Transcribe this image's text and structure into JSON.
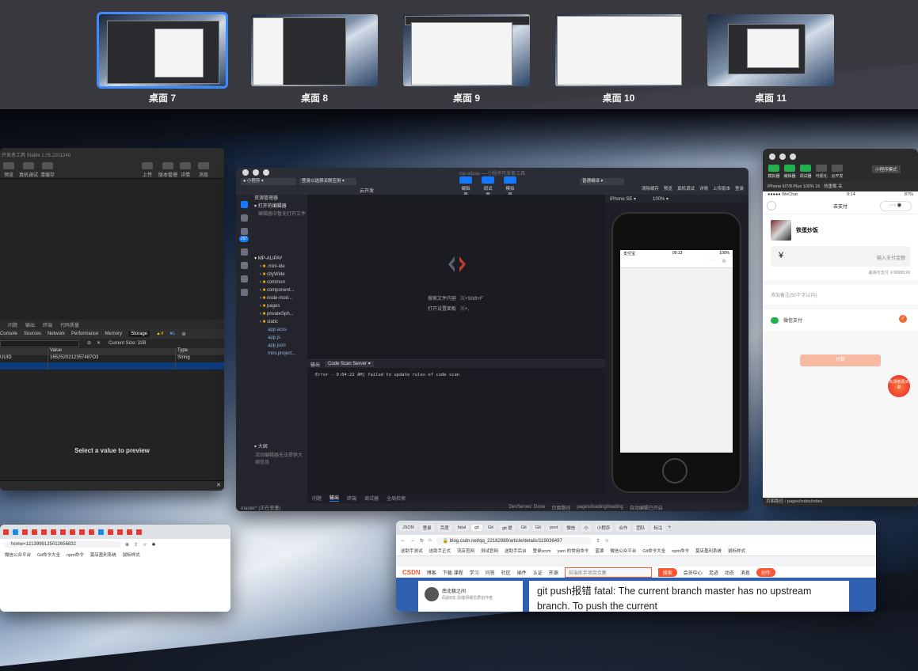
{
  "spaces": [
    {
      "label": "桌面 7",
      "selected": true
    },
    {
      "label": "桌面 8",
      "selected": false
    },
    {
      "label": "桌面 9",
      "selected": false
    },
    {
      "label": "桌面 10",
      "selected": false
    },
    {
      "label": "桌面 11",
      "selected": false
    }
  ],
  "left_window": {
    "title": "开发者工具 Stable 1.05.2201240",
    "toolbar": [
      "预览",
      "真机调试",
      "清缓存",
      "上传",
      "版本管理",
      "详情",
      "消息"
    ],
    "panel_tabs": [
      "问题",
      "输出",
      "终端",
      "代码质量"
    ],
    "devtools_tabs": [
      "Console",
      "Sources",
      "Network",
      "Performance",
      "Memory",
      "Storage"
    ],
    "active_tab": "Storage",
    "warnings": "4",
    "errors": "1",
    "current_size": "Current Size: 32B",
    "columns": [
      "Value",
      "Type"
    ],
    "rows": [
      {
        "key": "UUID",
        "value": "1652520212357487O3",
        "type": "String"
      }
    ],
    "preview_text": "Select a value to preview"
  },
  "ide": {
    "title": "mp-alipay — 小程序开发者工具",
    "project_select": "小程序",
    "login_select": "登录以选择关联应用",
    "cloud_label": "云开发",
    "center_buttons": [
      {
        "label": "编辑器",
        "on": true
      },
      {
        "label": "调试器",
        "on": true
      },
      {
        "label": "模拟器",
        "on": true
      }
    ],
    "compile_select": "普通编译",
    "right_buttons": [
      "清除缓存",
      "预览",
      "真机调试",
      "详情",
      "上传版本",
      "登录"
    ],
    "badge": "297",
    "explorer_title": "资源管理器",
    "open_editors": "打开的编辑器",
    "no_open": "编辑器中暂无打开文件",
    "project_root": "MP-ALIPAY",
    "folders": [
      ".mini-ide",
      "cityWide",
      "common",
      "component...",
      "node-mod...",
      "pages",
      "privateSph...",
      "static"
    ],
    "files": [
      "app.acss",
      "app.js",
      "app.json",
      "mini.project..."
    ],
    "hint_search": "搜索文件内容",
    "hint_search_key": "⌘+Shift+F",
    "hint_settings": "打开设置面板",
    "hint_settings_key": "⌘+,",
    "panel_title": "输出",
    "panel_select": "Code Scan Server",
    "log_line": "Error - 9:04:22 AM] failed to update rules of code scan",
    "outline_title": "大纲",
    "outline_text": "活动编辑器无法提供大纲信息",
    "bottom_tabs": [
      "问题",
      "输出",
      "终端",
      "调试器",
      "全局检索"
    ],
    "active_bottom_tab": "输出",
    "device": "iPhone SE",
    "zoom": "100%",
    "phone_carrier": "支付宝",
    "phone_time": "09:13",
    "phone_battery": "100%",
    "status_branch": "master* (正在变基)",
    "status_devserver": "DevServer: Done",
    "status_page_label": "页面路径",
    "status_page": "pages/loading/loading",
    "status_auto": "自动编辑已开启"
  },
  "mp_window": {
    "toolbar": [
      {
        "label": "模拟器",
        "green": true
      },
      {
        "label": "编辑器",
        "green": true
      },
      {
        "label": "调试器",
        "green": true
      },
      {
        "label": "可视化",
        "green": false
      },
      {
        "label": "云开发",
        "green": false
      }
    ],
    "mode": "小程序模式",
    "device": "iPhone 6/7/8 Plus 100% 16",
    "hot_reload": "热重载 关",
    "carrier": "●●●●● WeChat",
    "time": "9:14",
    "battery": "87%",
    "page_title": "去支付",
    "merchant": "铁蛋炒饭",
    "currency": "¥",
    "amount_placeholder": "输入支付金额",
    "max_pay": "最高可支付 ￥99999.99",
    "remark": "添加备注(50个字以内)",
    "pay_method": "微信支付",
    "pay_button": "付款",
    "promo": "先领券再买单",
    "footer_label": "页面路径",
    "footer_path": "pages/index/index"
  },
  "browser_left": {
    "url_tail": "home=1213999125012656832",
    "bookmarks": [
      "微信公众平台",
      "Git命令大全",
      "npm命令",
      "莫店盈利系统",
      "鼠标样式"
    ]
  },
  "browser_right": {
    "tabs": [
      "JSON",
      "登录",
      "百度",
      "fatal",
      "git",
      "Git",
      "git 提",
      "Git",
      "Git",
      "post",
      "微信",
      "小",
      "小程序",
      "合作",
      "团队",
      "标注"
    ],
    "url": "blog.csdn.net/qq_22182989/article/details/119036497",
    "bookmarks": [
      "送助手测试",
      "送助手正式",
      "流店官网",
      "测试官网",
      "送助手后台",
      "登录scrm",
      "yarn 的常用命令",
      "蓝湖",
      "微信公众平台",
      "Git命令大全",
      "npm命令",
      "莫店盈利系统",
      "鼠标样式"
    ],
    "nav": [
      "博客",
      "下载·课程",
      "学习",
      "问答",
      "社区",
      "插件",
      "认证",
      "开源"
    ],
    "search_placeholder": "前端练手项目合集",
    "search_button": "搜索",
    "user_links": [
      "会员中心",
      "足迹",
      "动态",
      "消息"
    ],
    "create_button": "创作",
    "author_name": "南北极之间",
    "author_sub": "码龄8年  前端领域优质创作者",
    "article_title": "git push报错 fatal: The current branch master has no upstream branch. To push the current"
  }
}
